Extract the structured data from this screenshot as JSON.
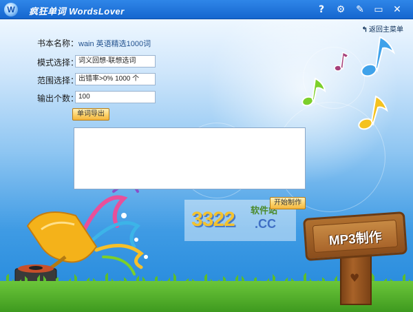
{
  "window": {
    "title": "疯狂单词 WordsLover",
    "icon_letter": "W",
    "controls": [
      "help-icon",
      "settings-icon",
      "edit-icon",
      "minimize-icon",
      "close-icon"
    ],
    "control_glyphs": {
      "help": "?",
      "settings": "⚙",
      "edit": "✎",
      "minimize": "▭",
      "close": "✕"
    }
  },
  "nav": {
    "back_label": "返回主菜单",
    "back_arrow": "↰"
  },
  "form": {
    "book_label": "书本名称：",
    "book_value": "wain   英语精选1000词",
    "mode_label": "模式选择：",
    "mode_value": "词义回想-联想选词",
    "range_label": "范围选择：",
    "range_value": "出错率>0%  1000 个",
    "count_label": "输出个数：",
    "count_value": "100"
  },
  "buttons": {
    "export_label": "单词导出",
    "start_label": "开始制作"
  },
  "output_box": {
    "value": ""
  },
  "watermark": {
    "number": "3322",
    "site": "软件站",
    "domain": ".CC"
  },
  "sign": {
    "text": "MP3制作"
  },
  "colors": {
    "titlebar": "#1e73d8",
    "button": "#fcd26a",
    "sign_wood": "#a8642a"
  }
}
